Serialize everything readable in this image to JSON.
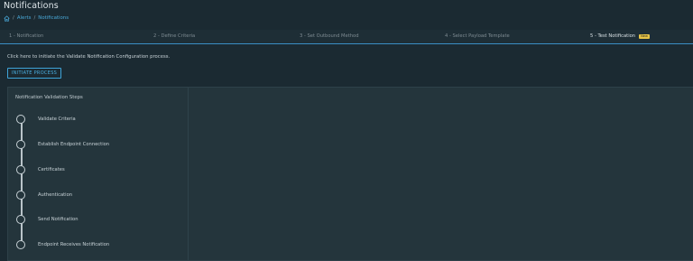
{
  "page": {
    "title": "Notifications"
  },
  "breadcrumb": {
    "home_icon": "home-icon",
    "separator": "/",
    "items": [
      "Alerts",
      "Notifications"
    ]
  },
  "wizard": {
    "steps": [
      {
        "label": "1 - Notification"
      },
      {
        "label": "2 - Define Criteria"
      },
      {
        "label": "3 - Set Outbound Method"
      },
      {
        "label": "4 - Select Payload Template"
      },
      {
        "label": "5 - Test Notification",
        "badge": "New"
      }
    ]
  },
  "content": {
    "instruction": "Click here to initiate the Validate Notification Configuration process.",
    "initiate_button": "INITIATE PROCESS"
  },
  "validation": {
    "title": "Notification Validation Steps",
    "steps": [
      "Validate Criteria",
      "Establish Endpoint Connection",
      "Certificates",
      "Authentication",
      "Send Notification",
      "Endpoint Receives Notification"
    ]
  },
  "colors": {
    "background": "#1b2a32",
    "panel": "#24353c",
    "accent": "#49a9d9",
    "badge": "#e8c547"
  }
}
